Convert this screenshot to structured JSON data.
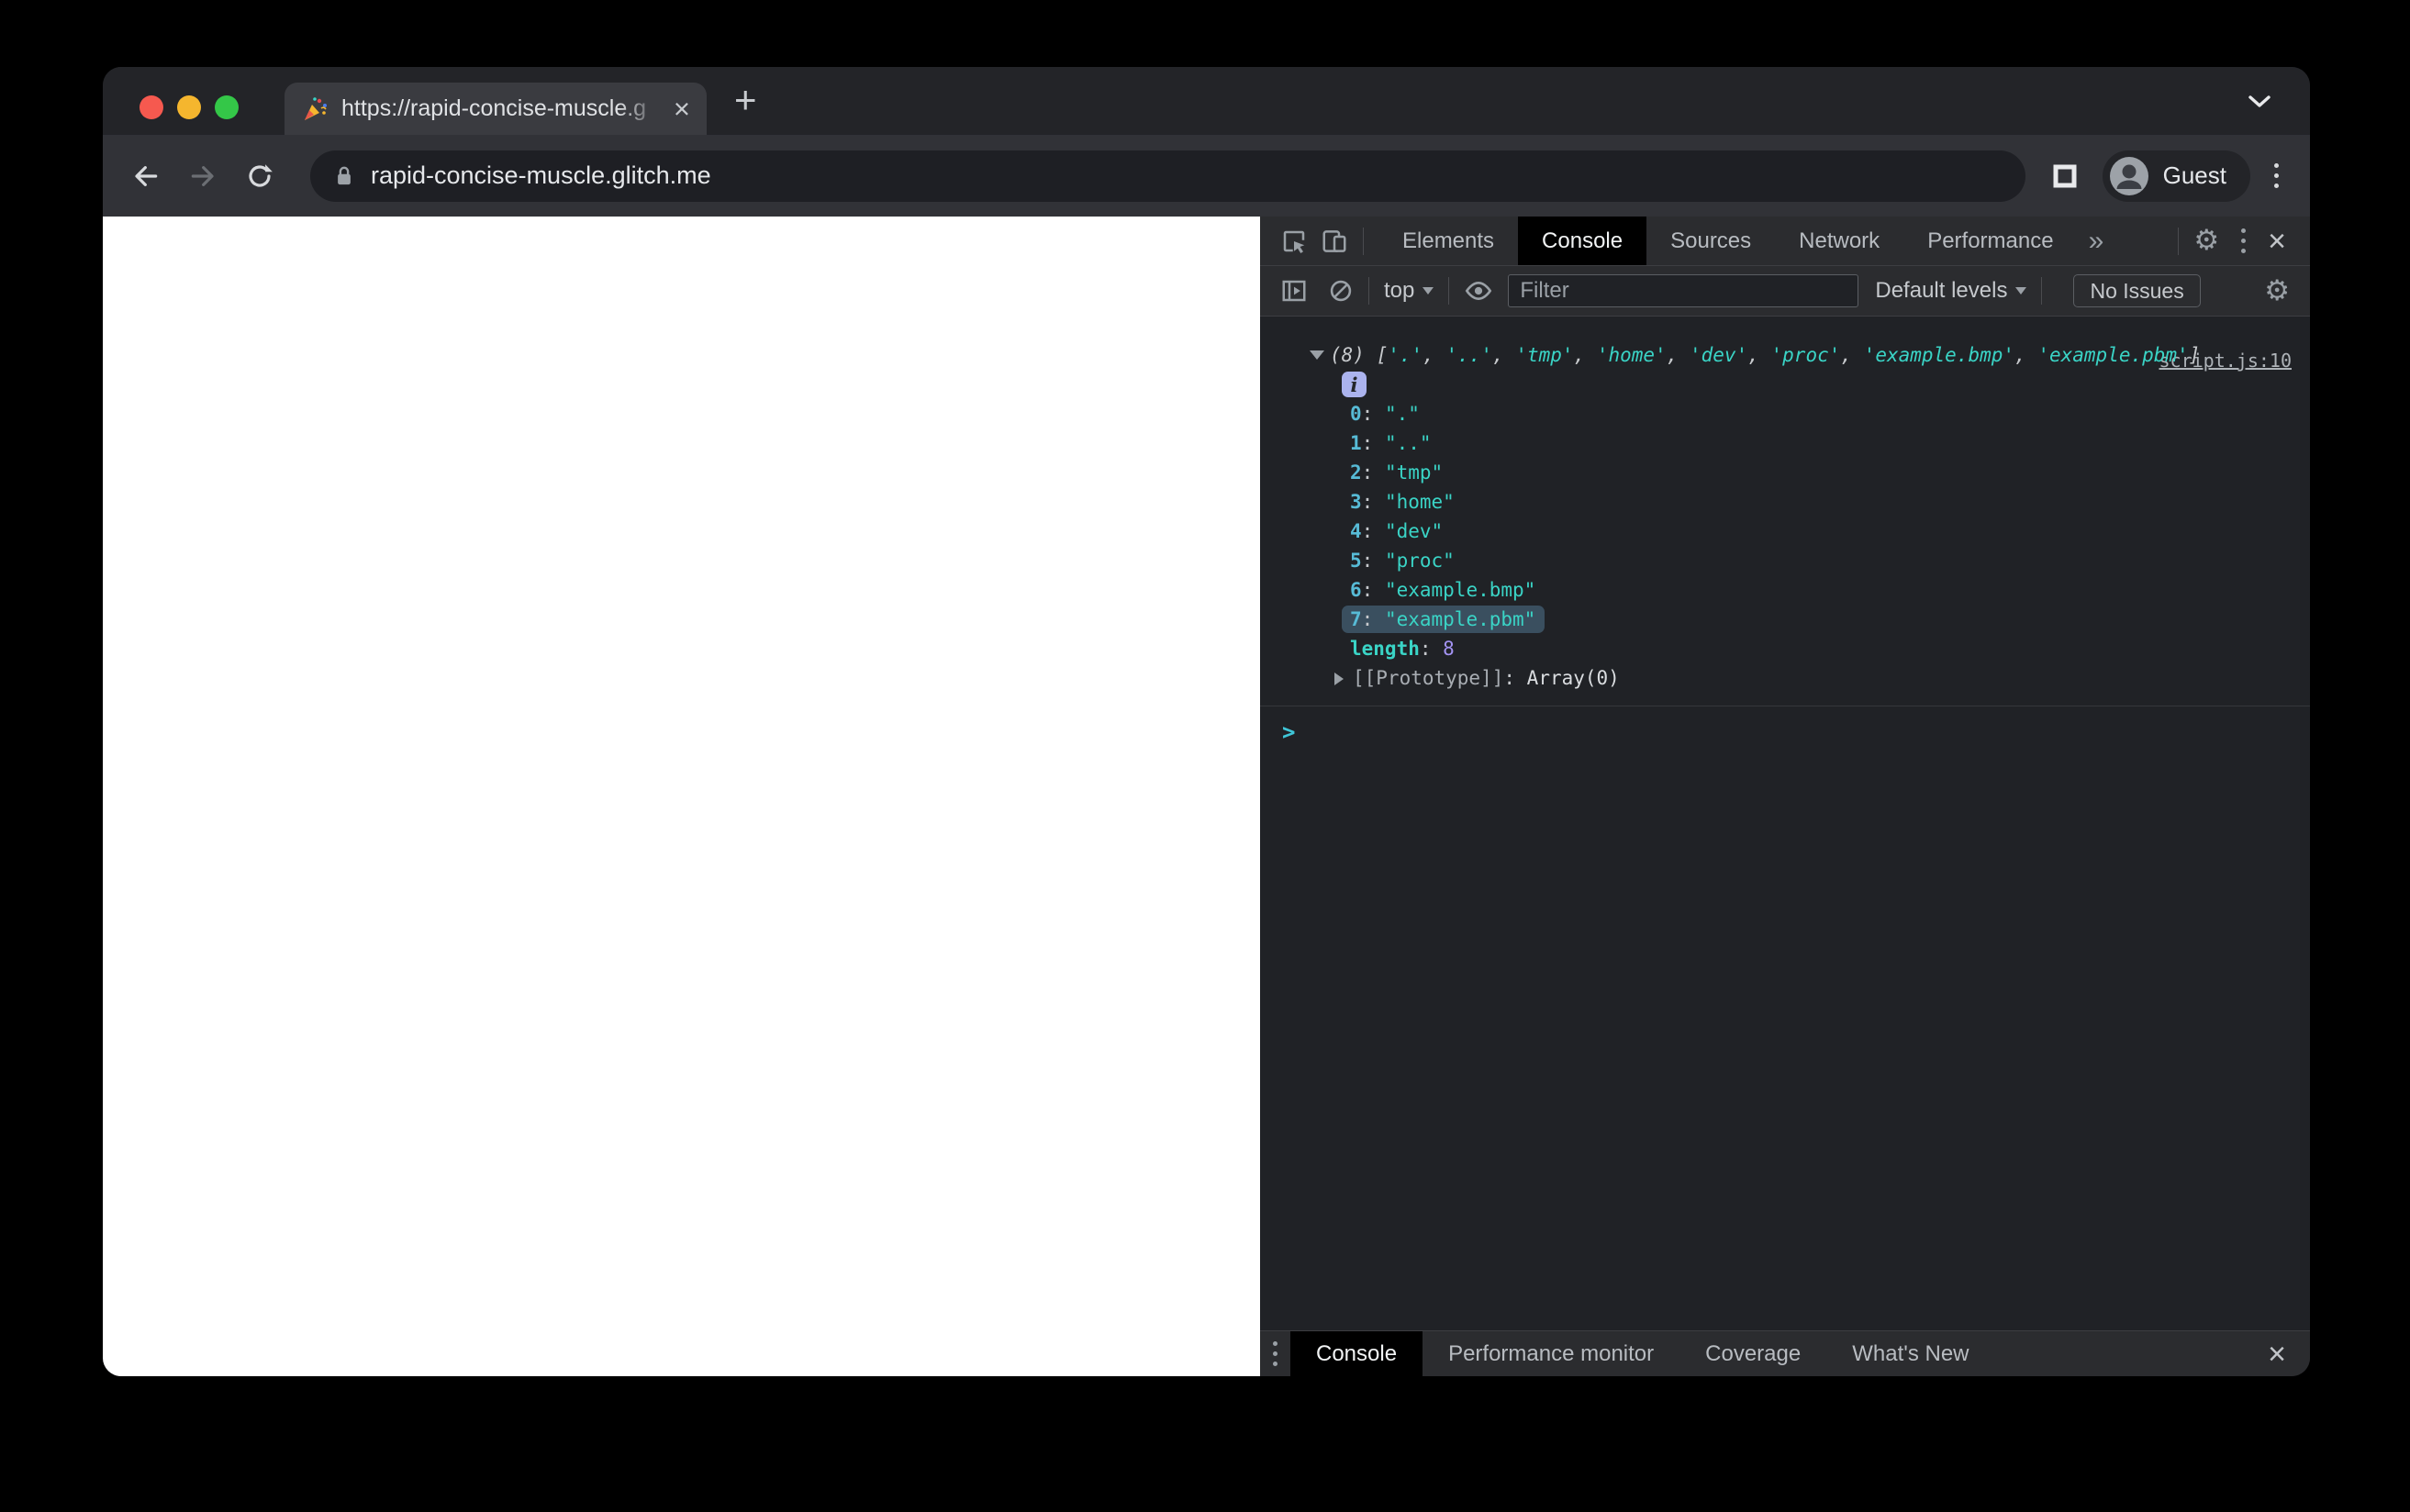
{
  "browser": {
    "traffic_lights": [
      "close",
      "minimize",
      "maximize"
    ],
    "tab": {
      "favicon": "party-popper",
      "title": "https://rapid-concise-muscle.g",
      "close_label": "×"
    },
    "new_tab_label": "+",
    "toolbar": {
      "url": "rapid-concise-muscle.glitch.me",
      "profile_label": "Guest"
    }
  },
  "devtools": {
    "tabs": [
      "Elements",
      "Console",
      "Sources",
      "Network",
      "Performance"
    ],
    "active_tab": "Console",
    "more_tabs_glyph": "»",
    "toolbar": {
      "context_label": "top",
      "filter_placeholder": "Filter",
      "levels_label": "Default levels",
      "issues_label": "No Issues"
    },
    "console": {
      "source_link": "script.js:10",
      "preview": {
        "count": "(8)",
        "open": "[",
        "close": "]",
        "separator": ", ",
        "items": [
          "'.'",
          "'..'",
          "'tmp'",
          "'home'",
          "'dev'",
          "'proc'",
          "'example.bmp'",
          "'example.pbm'"
        ]
      },
      "info_badge": "i",
      "entries": [
        {
          "index": "0",
          "value": "\".\""
        },
        {
          "index": "1",
          "value": "\"..\""
        },
        {
          "index": "2",
          "value": "\"tmp\""
        },
        {
          "index": "3",
          "value": "\"home\""
        },
        {
          "index": "4",
          "value": "\"dev\""
        },
        {
          "index": "5",
          "value": "\"proc\""
        },
        {
          "index": "6",
          "value": "\"example.bmp\""
        },
        {
          "index": "7",
          "value": "\"example.pbm\""
        }
      ],
      "highlighted_index": "7",
      "length_label": "length",
      "length_value": "8",
      "prototype_label": "[[Prototype]]",
      "prototype_value": "Array(0)",
      "prompt_symbol": ">"
    },
    "drawer": {
      "tabs": [
        "Console",
        "Performance monitor",
        "Coverage",
        "What's New"
      ],
      "active_tab": "Console",
      "close_label": "×"
    }
  },
  "colors": {
    "accent_string_teal": "#3AD4C6",
    "index_blue": "#57BBD6",
    "number_purple": "#A393F3",
    "highlight_row": "#3A4F5F",
    "info_badge_bg": "#ABB3EE",
    "traffic_red": "#F6594F",
    "traffic_yellow": "#F5B62E",
    "traffic_green": "#34C748"
  }
}
